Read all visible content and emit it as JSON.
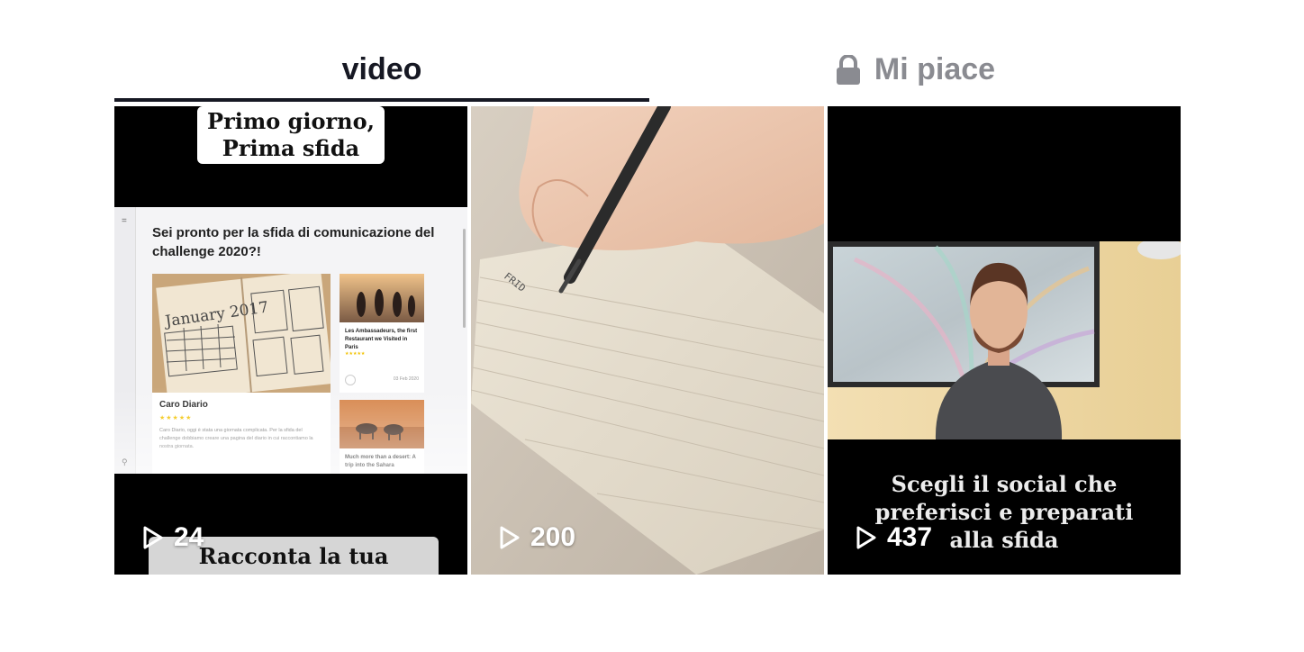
{
  "tabs": {
    "video_label": "video",
    "likes_label": "Mi piace",
    "active": "video"
  },
  "videos": [
    {
      "views": "24",
      "caption_top": [
        "Primo giorno,",
        "Prima sfida"
      ],
      "screen": {
        "heading": "Sei pronto per la sfida di comunicazione del challenge 2020?!",
        "main_card_title": "Caro Diario",
        "main_card_text": "Caro Diario, oggi è stata una giornata complicata. Per la sfida del challenge dobbiamo creare una pagina del diario in cui raccontiamo la nostra giornata.",
        "side_card_1_title": "Les Ambassadeurs, the first Restaurant we Visited in Paris",
        "side_card_1_date": "03 Feb 2020",
        "side_card_2_title": "Much more than a desert: A trip into the Sahara",
        "journal_text": "January 2017"
      },
      "caption_bottom": "Racconta la tua"
    },
    {
      "views": "200"
    },
    {
      "views": "437",
      "caption": [
        "Scegli il social che",
        "preferisci e preparati",
        "alla sfida"
      ]
    }
  ],
  "icons": {
    "lock": "lock-icon",
    "play": "play-icon"
  },
  "colors": {
    "active_tab": "#161823",
    "inactive_tab": "#8a8b91",
    "background": "#ffffff"
  }
}
